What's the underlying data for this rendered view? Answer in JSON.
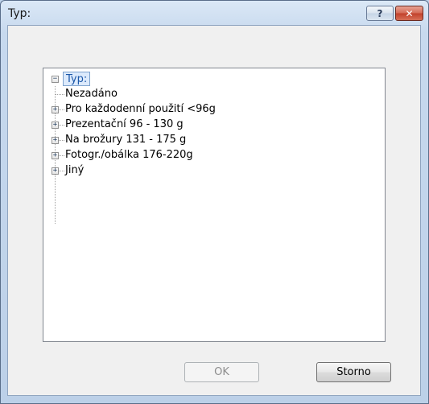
{
  "window": {
    "title": "Typ:",
    "help_glyph": "?",
    "close_glyph": "✕"
  },
  "tree": {
    "root_label": "Typ:",
    "root_expander": "−",
    "items": [
      {
        "label": "Nezadáno",
        "expandable": false
      },
      {
        "label": "Pro každodenní použití <96g",
        "expandable": true
      },
      {
        "label": "Prezentační 96 - 130 g",
        "expandable": true
      },
      {
        "label": "Na brožury 131 - 175 g",
        "expandable": true
      },
      {
        "label": "Fotogr./obálka 176-220g",
        "expandable": true
      },
      {
        "label": "Jiný",
        "expandable": true
      }
    ],
    "expander_glyph": "+"
  },
  "buttons": {
    "ok_label": "OK",
    "storno_label": "Storno"
  },
  "colors": {
    "selection_fill": "#dceafc",
    "selection_border": "#7da2ce",
    "close_red": "#c2402a"
  }
}
